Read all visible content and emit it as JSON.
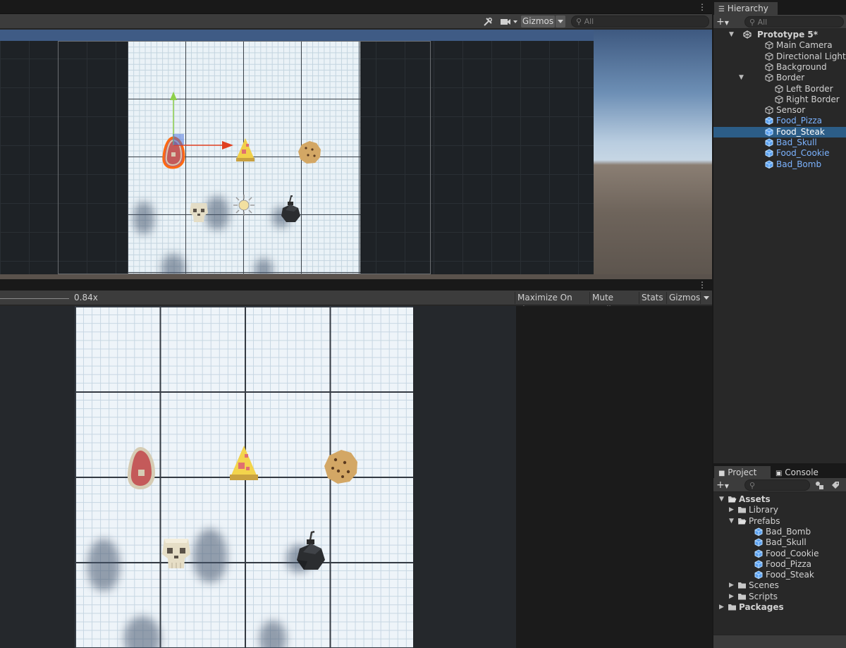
{
  "scene": {
    "toolbar": {
      "gizmos_label": "Gizmos",
      "search_placeholder": "All",
      "tools_icon": "tools-icon",
      "camera_icon": "camera-icon"
    },
    "objects": [
      "Food_Steak",
      "Food_Pizza",
      "Food_Cookie",
      "Bad_Skull",
      "Sensor",
      "Bad_Bomb"
    ]
  },
  "game": {
    "toolbar": {
      "zoom_label": "0.84x",
      "maximize_label": "Maximize On Play",
      "mute_label": "Mute Audio",
      "stats_label": "Stats",
      "gizmos_label": "Gizmos"
    }
  },
  "hierarchy": {
    "tab_label": "Hierarchy",
    "search_placeholder": "All",
    "items": [
      {
        "label": "Prototype 5*",
        "depth": 0,
        "type": "scene",
        "expanded": true
      },
      {
        "label": "Main Camera",
        "depth": 1,
        "type": "object"
      },
      {
        "label": "Directional Light",
        "depth": 1,
        "type": "object"
      },
      {
        "label": "Background",
        "depth": 1,
        "type": "object"
      },
      {
        "label": "Border",
        "depth": 1,
        "type": "object",
        "expanded": true
      },
      {
        "label": "Left Border",
        "depth": 2,
        "type": "object"
      },
      {
        "label": "Right Border",
        "depth": 2,
        "type": "object"
      },
      {
        "label": "Sensor",
        "depth": 1,
        "type": "object"
      },
      {
        "label": "Food_Pizza",
        "depth": 1,
        "type": "prefab"
      },
      {
        "label": "Food_Steak",
        "depth": 1,
        "type": "prefab",
        "selected": true
      },
      {
        "label": "Bad_Skull",
        "depth": 1,
        "type": "prefab"
      },
      {
        "label": "Food_Cookie",
        "depth": 1,
        "type": "prefab"
      },
      {
        "label": "Bad_Bomb",
        "depth": 1,
        "type": "prefab"
      }
    ]
  },
  "project": {
    "tab_project": "Project",
    "tab_console": "Console",
    "items": [
      {
        "label": "Assets",
        "depth": 0,
        "type": "folder-open",
        "bold": true,
        "arrow": "down"
      },
      {
        "label": "Library",
        "depth": 1,
        "type": "folder",
        "arrow": "right"
      },
      {
        "label": "Prefabs",
        "depth": 1,
        "type": "folder-open",
        "arrow": "down"
      },
      {
        "label": "Bad_Bomb",
        "depth": 2,
        "type": "prefab"
      },
      {
        "label": "Bad_Skull",
        "depth": 2,
        "type": "prefab"
      },
      {
        "label": "Food_Cookie",
        "depth": 2,
        "type": "prefab"
      },
      {
        "label": "Food_Pizza",
        "depth": 2,
        "type": "prefab"
      },
      {
        "label": "Food_Steak",
        "depth": 2,
        "type": "prefab"
      },
      {
        "label": "Scenes",
        "depth": 1,
        "type": "folder",
        "arrow": "right"
      },
      {
        "label": "Scripts",
        "depth": 1,
        "type": "folder",
        "arrow": "right"
      },
      {
        "label": "Packages",
        "depth": 0,
        "type": "folder",
        "bold": true,
        "arrow": "right"
      }
    ]
  },
  "colors": {
    "accent": "#2c5d87",
    "prefab_text": "#7cb3ff",
    "panel_bg": "#282828",
    "toolbar_bg": "#3c3c3c"
  }
}
